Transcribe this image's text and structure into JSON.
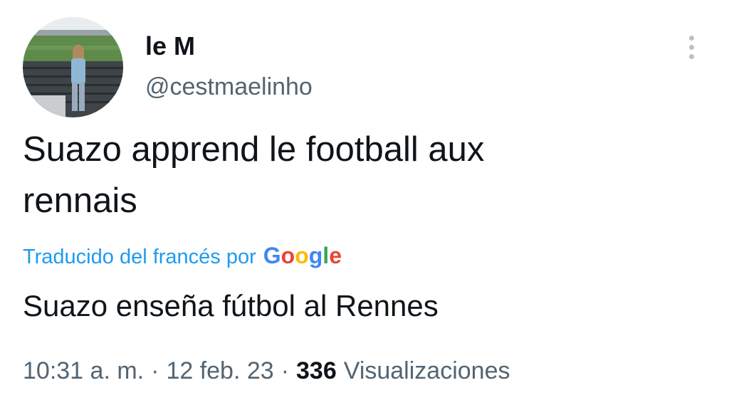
{
  "tweet": {
    "author": {
      "display_name": "le M",
      "handle": "@cestmaelinho"
    },
    "text_line1": "Suazo apprend le football aux",
    "text_line2": "rennais",
    "translation": {
      "label": "Traducido del francés por",
      "provider_letters": [
        "G",
        "o",
        "o",
        "g",
        "l",
        "e"
      ],
      "provider_colors": [
        "#4285f4",
        "#ea4335",
        "#fbbc05",
        "#4285f4",
        "#34a853",
        "#ea4335"
      ],
      "text": "Suazo enseña fútbol al Rennes"
    },
    "meta": {
      "time": "10:31 a. m.",
      "separator": "·",
      "date": "12 feb. 23",
      "views_count": "336",
      "views_label": "Visualizaciones"
    }
  },
  "icons": {
    "more": "more-vertical-icon"
  },
  "colors": {
    "text_primary": "#0f1419",
    "text_secondary": "#536471",
    "link_blue": "#1d9bf0",
    "more_dots": "#b9c1c8"
  }
}
